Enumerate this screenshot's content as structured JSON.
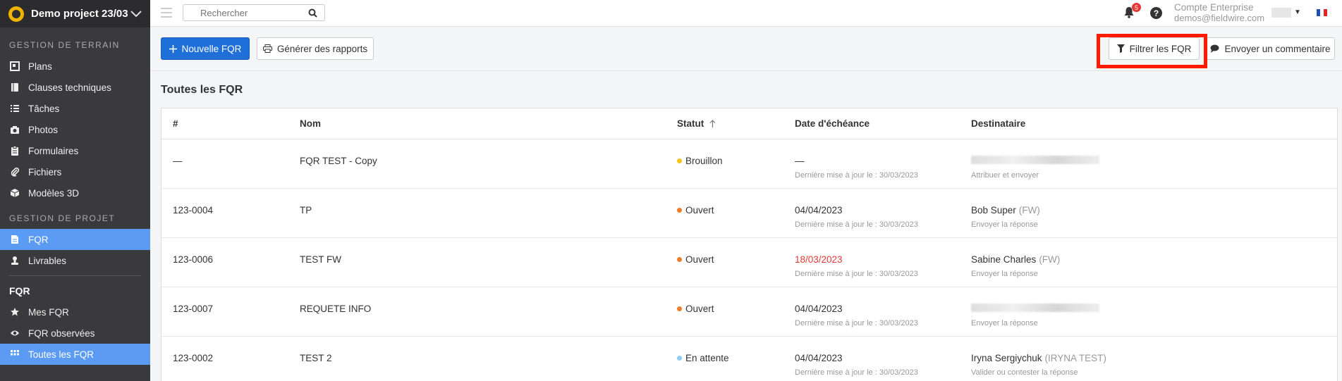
{
  "sidebar": {
    "project_name": "Demo project 23/03",
    "section_terrain": "GESTION DE TERRAIN",
    "terrain_items": [
      {
        "label": "Plans",
        "icon": "plans-icon"
      },
      {
        "label": "Clauses techniques",
        "icon": "notebook-icon"
      },
      {
        "label": "Tâches",
        "icon": "list-icon"
      },
      {
        "label": "Photos",
        "icon": "camera-icon"
      },
      {
        "label": "Formulaires",
        "icon": "clipboard-icon"
      },
      {
        "label": "Fichiers",
        "icon": "paperclip-icon"
      },
      {
        "label": "Modèles 3D",
        "icon": "cube-icon"
      }
    ],
    "section_projet": "GESTION DE PROJET",
    "projet_items": [
      {
        "label": "FQR",
        "icon": "document-icon"
      },
      {
        "label": "Livrables",
        "icon": "stamp-icon"
      }
    ],
    "fqr_heading": "FQR",
    "fqr_items": [
      {
        "label": "Mes FQR",
        "icon": "star-icon"
      },
      {
        "label": "FQR observées",
        "icon": "eye-icon"
      },
      {
        "label": "Toutes les FQR",
        "icon": "grid-icon"
      }
    ]
  },
  "topbar": {
    "search_placeholder": "Rechercher",
    "notification_count": "5",
    "help_label": "?",
    "account_name": "Compte Enterprise",
    "account_email": "demos@fieldwire.com"
  },
  "actions": {
    "new_label": "Nouvelle FQR",
    "reports_label": "Générer des rapports",
    "filter_label": "Filtrer les FQR",
    "feedback_label": "Envoyer un commentaire"
  },
  "page": {
    "title": "Toutes les FQR"
  },
  "table": {
    "columns": [
      "#",
      "Nom",
      "Statut",
      "Date d'échéance",
      "Destinataire"
    ],
    "rows": [
      {
        "num": "—",
        "name": "FQR TEST - Copy",
        "status": "Brouillon",
        "status_color": "#f5c518",
        "due": "—",
        "due_overdue": false,
        "updated": "Dernière mise à jour le : 30/03/2023",
        "assignee": "",
        "assignee_tag": "",
        "action": "Attribuer et envoyer"
      },
      {
        "num": "123-0004",
        "name": "TP",
        "status": "Ouvert",
        "status_color": "#f07c2a",
        "due": "04/04/2023",
        "due_overdue": false,
        "updated": "Dernière mise à jour le : 30/03/2023",
        "assignee": "Bob Super",
        "assignee_tag": "(FW)",
        "action": "Envoyer la réponse"
      },
      {
        "num": "123-0006",
        "name": "TEST FW",
        "status": "Ouvert",
        "status_color": "#f07c2a",
        "due": "18/03/2023",
        "due_overdue": true,
        "updated": "Dernière mise à jour le : 30/03/2023",
        "assignee": "Sabine Charles",
        "assignee_tag": "(FW)",
        "action": "Envoyer la réponse"
      },
      {
        "num": "123-0007",
        "name": "REQUETE INFO",
        "status": "Ouvert",
        "status_color": "#f07c2a",
        "due": "04/04/2023",
        "due_overdue": false,
        "updated": "Dernière mise à jour le : 30/03/2023",
        "assignee": "",
        "assignee_tag": "",
        "action": "Envoyer la réponse"
      },
      {
        "num": "123-0002",
        "name": "TEST 2",
        "status": "En attente",
        "status_color": "#8ecbf5",
        "due": "04/04/2023",
        "due_overdue": false,
        "updated": "Dernière mise à jour le : 30/03/2023",
        "assignee": "Iryna Sergiychuk",
        "assignee_tag": "(IRYNA TEST)",
        "action": "Valider ou contester la réponse"
      }
    ]
  }
}
